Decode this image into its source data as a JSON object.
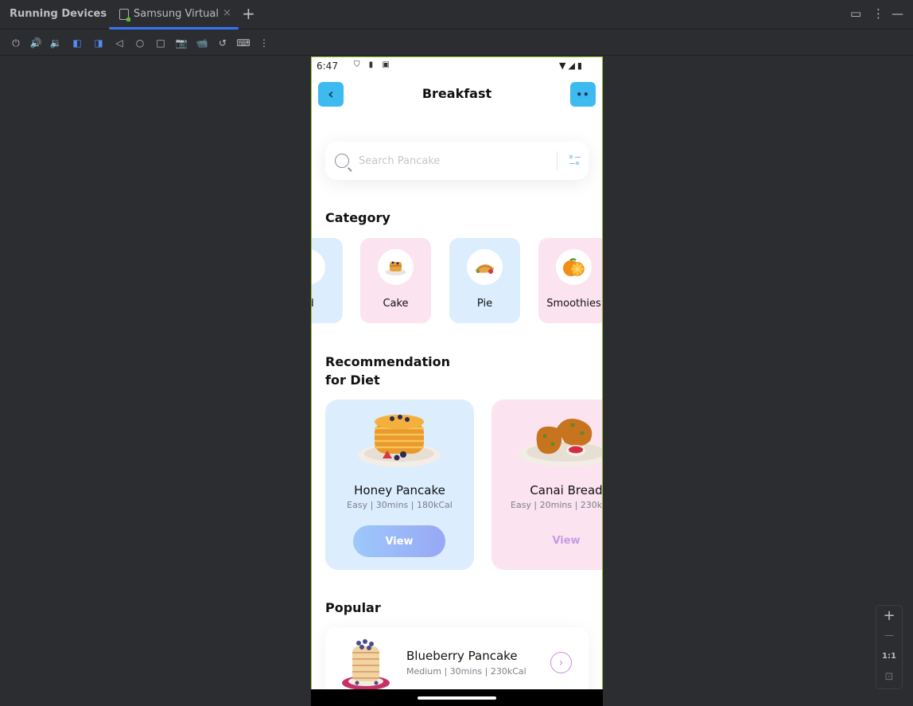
{
  "ide": {
    "panel_title": "Running Devices",
    "tab_label": "Samsung Virtual",
    "tab_close": "×",
    "tab_add": "+",
    "window_buttons": [
      "▭",
      "⋮",
      "—"
    ],
    "toolbar_icons": [
      "power-icon",
      "volume-up-icon",
      "volume-down-icon",
      "rotate-left-icon",
      "rotate-right-icon",
      "back-icon",
      "home-icon",
      "overview-icon",
      "screenshot-icon",
      "screen-record-icon",
      "reset-icon",
      "keyboard-icon",
      "more-icon"
    ],
    "toolbar_glyphs": [
      "⏻",
      "🔊",
      "🔉",
      "◧",
      "◨",
      "◁",
      "○",
      "□",
      "📷",
      "📹",
      "↺",
      "⌨",
      "⋮"
    ],
    "zoom": {
      "plus": "+",
      "minus": "—",
      "one_to_one": "1:1",
      "fit": "⊡"
    }
  },
  "device": {
    "status": {
      "time": "6:47",
      "left_icons": "⛉ ▮ ▣",
      "right_icons": "▼◢▮"
    },
    "header": {
      "back": "‹",
      "title": "Breakfast",
      "more": "••"
    },
    "search": {
      "placeholder": "Search Pancake"
    },
    "category": {
      "title": "Category",
      "items": [
        {
          "label": "ad",
          "bg": "#dcedfd",
          "emoji": "🥗"
        },
        {
          "label": "Cake",
          "bg": "#fbe3ef",
          "emoji": "🥞"
        },
        {
          "label": "Pie",
          "bg": "#dcedfd",
          "emoji": "🥧"
        },
        {
          "label": "Smoothies",
          "bg": "#fbe3ef",
          "emoji": "🍊"
        }
      ]
    },
    "recommendation": {
      "title_line1": "Recommendation",
      "title_line2": "for Diet",
      "items": [
        {
          "name": "Honey Pancake",
          "meta": "Easy | 30mins | 180kCal",
          "action": "View",
          "bg": "#dcedfd"
        },
        {
          "name": "Canai Bread",
          "meta": "Easy | 20mins | 230k",
          "action": "View",
          "bg": "#fbe3ef"
        }
      ]
    },
    "popular": {
      "title": "Popular",
      "items": [
        {
          "name": "Blueberry Pancake",
          "meta": "Medium | 30mins | 230kCal",
          "arrow": "›"
        }
      ]
    }
  }
}
